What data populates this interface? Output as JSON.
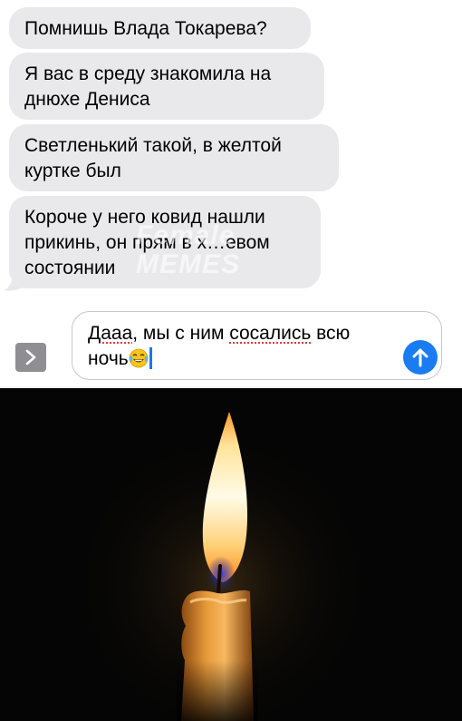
{
  "messages": [
    {
      "text": "Помнишь Влада Токарева?"
    },
    {
      "text": "Я вас в среду знакомила на днюхе Дениса"
    },
    {
      "text": "Светленький такой, в желтой куртке был"
    },
    {
      "text": "Короче у него ковид нашли прикинь, он прям в х…евом состоянии"
    }
  ],
  "watermark": {
    "line1": "Female",
    "line2": "MEMES"
  },
  "composer": {
    "word1": "Дааа",
    "part2": ", мы с ним ",
    "word3": "сосались",
    "part4": " всю ночь",
    "emoji": "face-with-tears-of-joy-emoji"
  },
  "icons": {
    "apps": "chevron-right-icon",
    "send": "arrow-up-icon"
  },
  "colors": {
    "bubble_gray": "#e9e9eb",
    "send_blue": "#1a7cf2",
    "caret_blue": "#1878f3",
    "spell_red": "#e53935"
  },
  "photo": {
    "subject": "candle-flame-image"
  }
}
